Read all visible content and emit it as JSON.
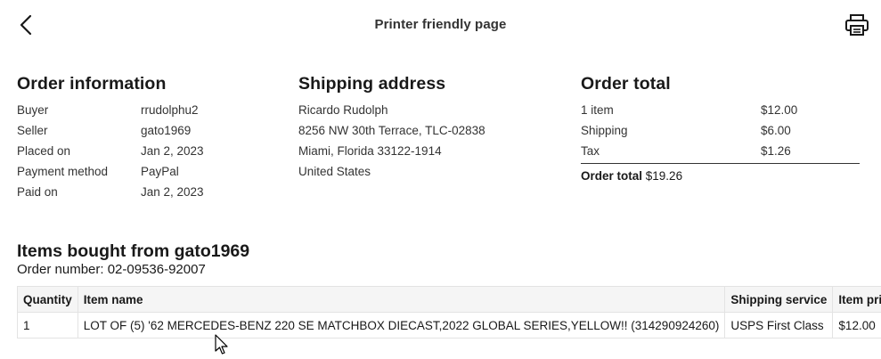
{
  "header": {
    "title": "Printer friendly page",
    "back_icon": "chevron-left-icon",
    "print_icon": "printer-icon"
  },
  "order_information": {
    "heading": "Order information",
    "rows": [
      {
        "label": "Buyer",
        "value": "rrudolphu2"
      },
      {
        "label": "Seller",
        "value": "gato1969"
      },
      {
        "label": "Placed on",
        "value": "Jan 2, 2023"
      },
      {
        "label": "Payment method",
        "value": "PayPal"
      },
      {
        "label": "Paid on",
        "value": "Jan 2, 2023"
      }
    ]
  },
  "shipping_address": {
    "heading": "Shipping address",
    "lines": [
      "Ricardo Rudolph",
      "8256 NW 30th Terrace, TLC-02838",
      "Miami, Florida 33122-1914",
      "United States"
    ]
  },
  "order_total": {
    "heading": "Order total",
    "rows": [
      {
        "label": "1 item",
        "value": "$12.00"
      },
      {
        "label": "Shipping",
        "value": "$6.00"
      },
      {
        "label": "Tax",
        "value": "$1.26"
      }
    ],
    "total_label": "Order total",
    "total_value": "$19.26"
  },
  "items": {
    "heading": "Items bought from gato1969",
    "order_number": "Order number: 02-09536-92007",
    "columns": [
      "Quantity",
      "Item name",
      "Shipping service",
      "Item price"
    ],
    "rows": [
      {
        "quantity": "1",
        "item_name": "LOT OF (5) '62 MERCEDES-BENZ 220 SE MATCHBOX DIECAST,2022 GLOBAL SERIES,YELLOW!! (314290924260)",
        "shipping_service": "USPS First Class",
        "price": "$12.00"
      }
    ]
  }
}
